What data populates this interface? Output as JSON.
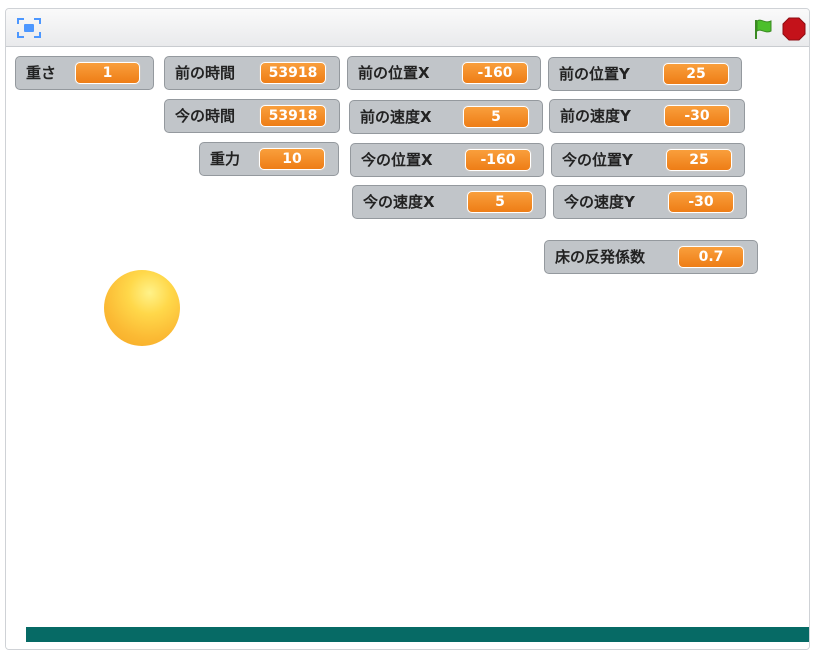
{
  "toolbar": {
    "fullscreen_icon": "fullscreen-icon",
    "green_flag_icon": "green-flag-icon",
    "stop_icon": "stop-sign-icon"
  },
  "colors": {
    "monitor_bg": "#c1c5c9",
    "value_bg": "#ee7d16",
    "floor": "#066a65",
    "ball": "#fbba34",
    "flag": "#4cbf2b",
    "stop": "#c4121a"
  },
  "monitors": {
    "weight": {
      "label": "重さ",
      "value": "1"
    },
    "prev_time": {
      "label": "前の時間",
      "value": "53918"
    },
    "prev_pos_x": {
      "label": "前の位置X",
      "value": "-160"
    },
    "prev_pos_y": {
      "label": "前の位置Y",
      "value": "25"
    },
    "now_time": {
      "label": "今の時間",
      "value": "53918"
    },
    "prev_vel_x": {
      "label": "前の速度X",
      "value": "5"
    },
    "prev_vel_y": {
      "label": "前の速度Y",
      "value": "-30"
    },
    "gravity": {
      "label": "重力",
      "value": "10"
    },
    "now_pos_x": {
      "label": "今の位置X",
      "value": "-160"
    },
    "now_pos_y": {
      "label": "今の位置Y",
      "value": "25"
    },
    "now_vel_x": {
      "label": "今の速度X",
      "value": "5"
    },
    "now_vel_y": {
      "label": "今の速度Y",
      "value": "-30"
    },
    "restitution": {
      "label": "床の反発係数",
      "value": "0.7"
    }
  }
}
